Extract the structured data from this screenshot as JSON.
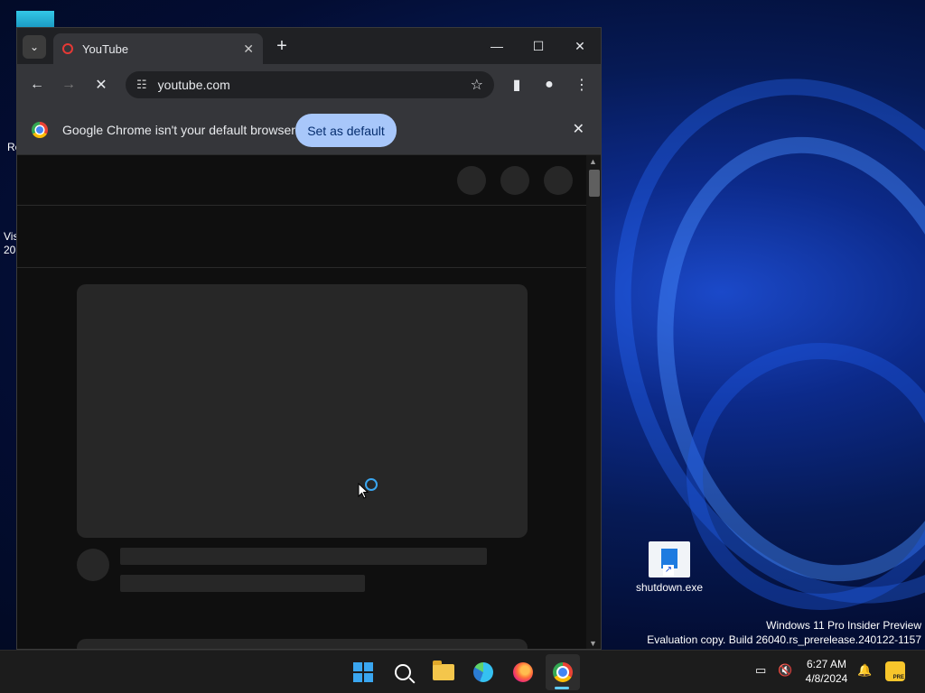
{
  "desktop": {
    "shortcut_label": "shutdown.exe",
    "partial_labels": [
      "Re",
      "Vis",
      "20"
    ],
    "watermark_line1": "Windows 11 Pro Insider Preview",
    "watermark_line2": "Evaluation copy. Build 26040.rs_prerelease.240122-1157"
  },
  "browser": {
    "tab_title": "YouTube",
    "url": "youtube.com",
    "infobar_text": "Google Chrome isn't your default browser",
    "set_default_label": "Set as default"
  },
  "taskbar": {
    "time": "6:27 AM",
    "date": "4/8/2024",
    "badge": "PRE"
  },
  "colors": {
    "accent": "#a8c7fa",
    "windows_blue": "#3aa6f0"
  }
}
